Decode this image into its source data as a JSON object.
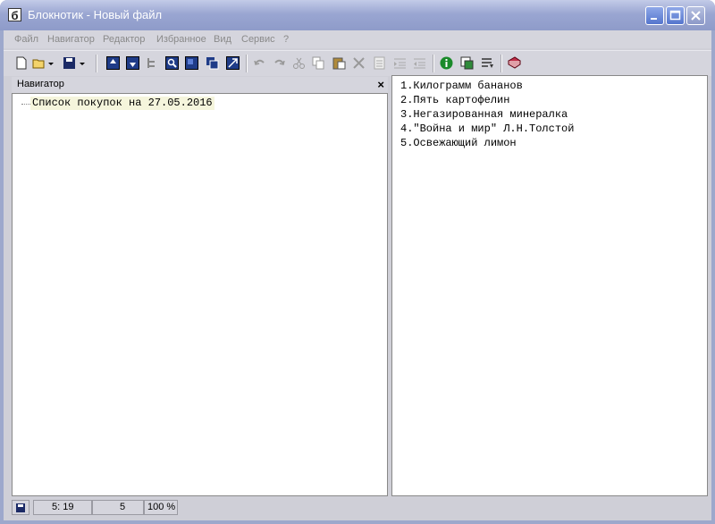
{
  "window": {
    "title": "Блокнотик - Новый файл",
    "app_icon_glyph": "б",
    "controls": {
      "minimize_icon": "minimize-icon",
      "maximize_icon": "maximize-icon",
      "close_icon": "close-icon"
    }
  },
  "menu": [
    "Файл",
    "Навигатор",
    "Редактор",
    "Избранное",
    "Вид",
    "Сервис",
    "?"
  ],
  "toolbar": {
    "icons": [
      "new-file-icon",
      "open-folder-icon",
      "dropdown-arrow-icon",
      "save-icon",
      "dropdown-arrow-icon",
      "nav-up-icon",
      "nav-down-icon",
      "tree-icon",
      "search-icon",
      "window-icon",
      "cascade-icon",
      "collapse-icon",
      "undo-icon",
      "redo-icon",
      "cut-icon",
      "copy-icon",
      "paste-icon",
      "delete-icon",
      "document-icon",
      "indent-icon",
      "outdent-icon",
      "info-icon",
      "preview-icon",
      "insert-icon",
      "book-icon"
    ]
  },
  "navigator": {
    "title": "Навигатор",
    "close_glyph": "×",
    "items": [
      "Список покупок на 27.05.2016"
    ]
  },
  "editor": {
    "lines": [
      "1.Килограмм бананов",
      "2.Пять картофелин",
      "3.Негазированная минералка",
      "4.\"Война и мир\" Л.Н.Толстой",
      "5.Освежающий лимон"
    ]
  },
  "status": {
    "save_icon": "save-icon",
    "position": "5: 19",
    "lines": "5",
    "zoom": "100 %"
  },
  "colors": {
    "titlebar": "#9aa6d2",
    "chrome": "#d5d5dd",
    "tree_highlight": "#f5f5dc"
  }
}
